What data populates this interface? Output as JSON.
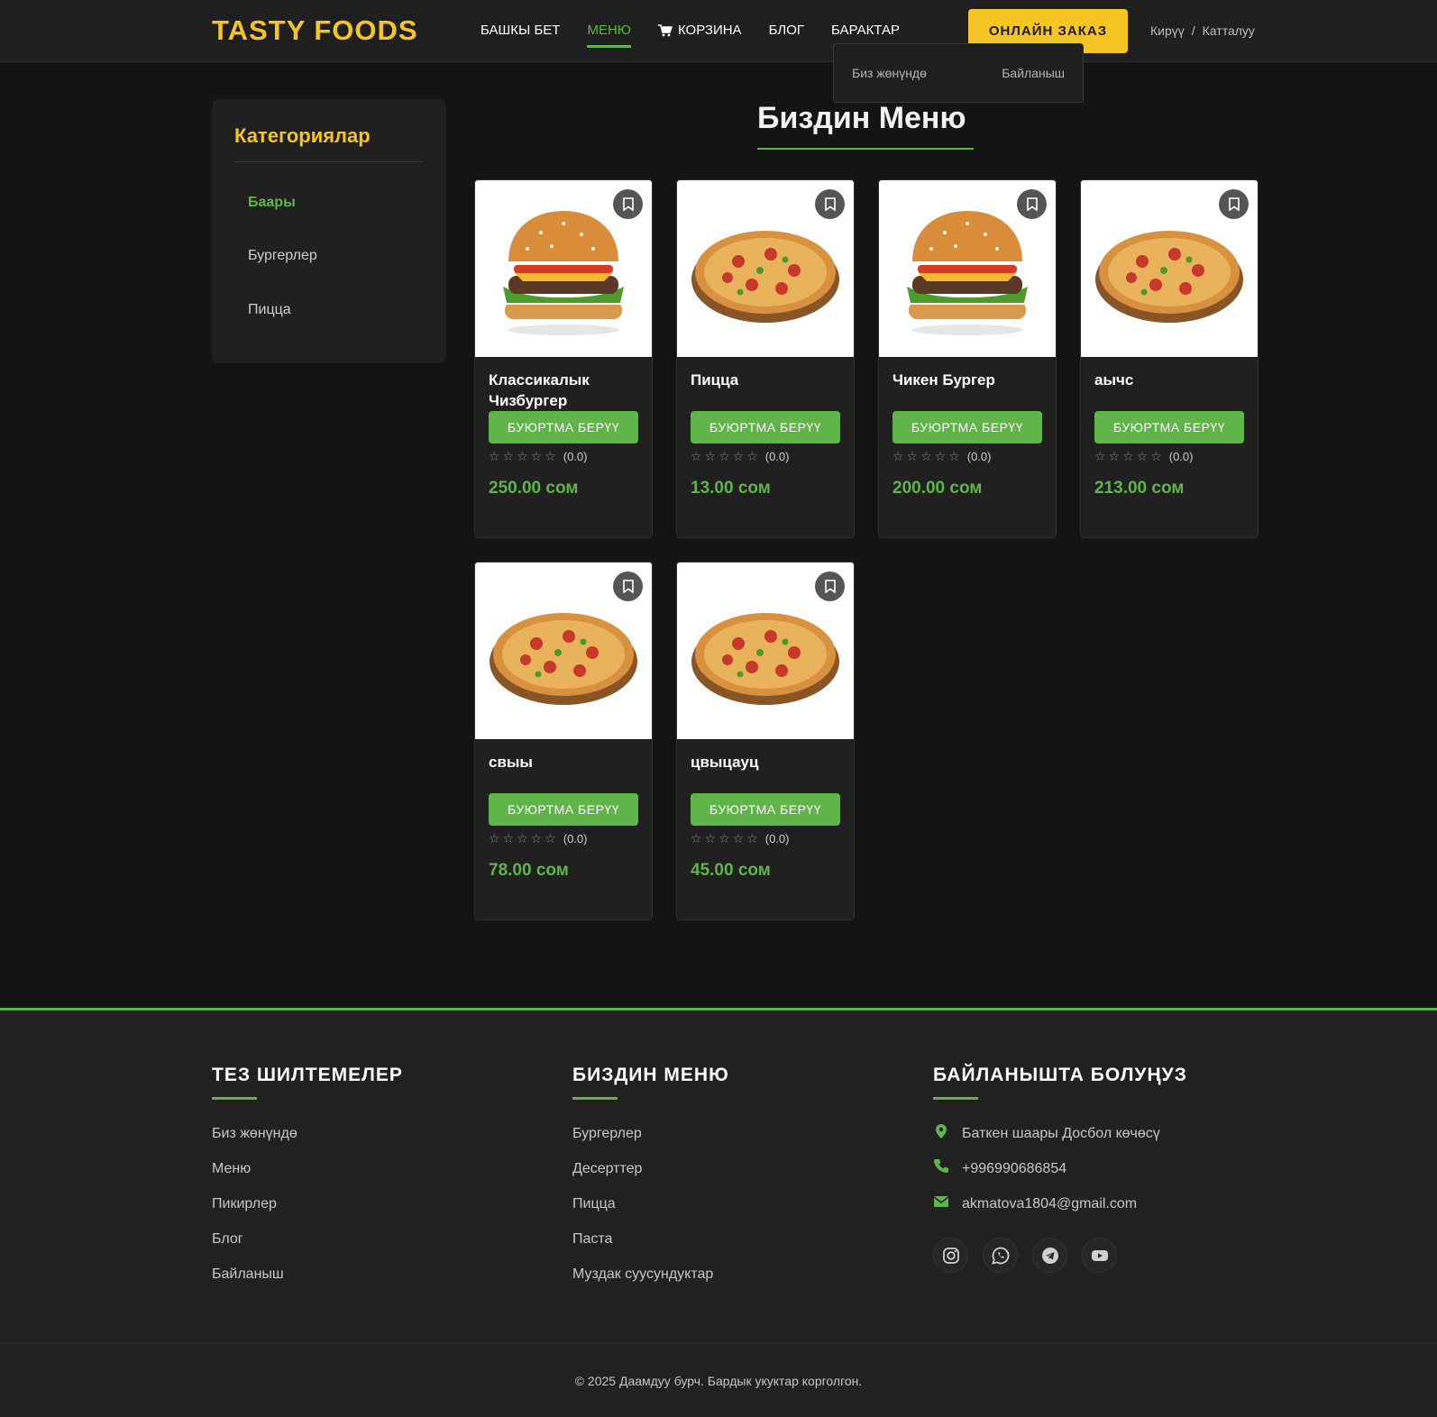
{
  "header": {
    "logo": "TASTY FOODS",
    "nav": [
      {
        "label": "БАШКЫ БЕТ"
      },
      {
        "label": "МЕНЮ"
      },
      {
        "label": "КОРЗИНА"
      },
      {
        "label": "БЛОГ"
      },
      {
        "label": "БАРАКТАР"
      }
    ],
    "order_button": "ОНЛАЙН ЗАКАЗ",
    "login": "Кирүү",
    "separator": "/",
    "register": "Катталуу",
    "dropdown": [
      "Биз жөнүндө",
      "Байланыш"
    ]
  },
  "sidebar": {
    "title": "Категориялар",
    "items": [
      {
        "label": "Баары"
      },
      {
        "label": "Бургерлер"
      },
      {
        "label": "Пицца"
      }
    ]
  },
  "main": {
    "title": "Биздин Меню",
    "order_label": "БУЮРТМА БЕРҮҮ",
    "products": [
      {
        "name": "Классикалык Чизбургер",
        "rating": "(0.0)",
        "price": "250.00 сом",
        "type": "burger"
      },
      {
        "name": "Пицца",
        "rating": "(0.0)",
        "price": "13.00 сом",
        "type": "pizza"
      },
      {
        "name": "Чикен Бургер",
        "rating": "(0.0)",
        "price": "200.00 сом",
        "type": "burger"
      },
      {
        "name": "аычс",
        "rating": "(0.0)",
        "price": "213.00 сом",
        "type": "pizza"
      },
      {
        "name": "свыы",
        "rating": "(0.0)",
        "price": "78.00 сом",
        "type": "pizza"
      },
      {
        "name": "цвыцауц",
        "rating": "(0.0)",
        "price": "45.00 сом",
        "type": "pizza"
      }
    ]
  },
  "footer": {
    "quick_links": {
      "title": "ТЕЗ ШИЛТЕМЕЛЕР",
      "items": [
        "Биз жөнүндө",
        "Меню",
        "Пикирлер",
        "Блог",
        "Байланыш"
      ]
    },
    "our_menu": {
      "title": "БИЗДИН МЕНЮ",
      "items": [
        "Бургерлер",
        "Десерттер",
        "Пицца",
        "Паста",
        "Муздак суусундуктар"
      ]
    },
    "contact": {
      "title": "БАЙЛАНЫШТА БОЛУҢУЗ",
      "address": "Баткен шаары Досбол көчөсү",
      "phone": "+996990686854",
      "email": "akmatova1804@gmail.com",
      "socials": [
        "instagram-icon",
        "whatsapp-icon",
        "telegram-icon",
        "youtube-icon"
      ]
    },
    "copyright": "© 2025 Даамдуу бурч. Бардык укуктар корголгон."
  },
  "colors": {
    "accent_green": "#5fb548",
    "accent_yellow": "#f5c523",
    "background": "#141414",
    "panel": "#202020"
  }
}
